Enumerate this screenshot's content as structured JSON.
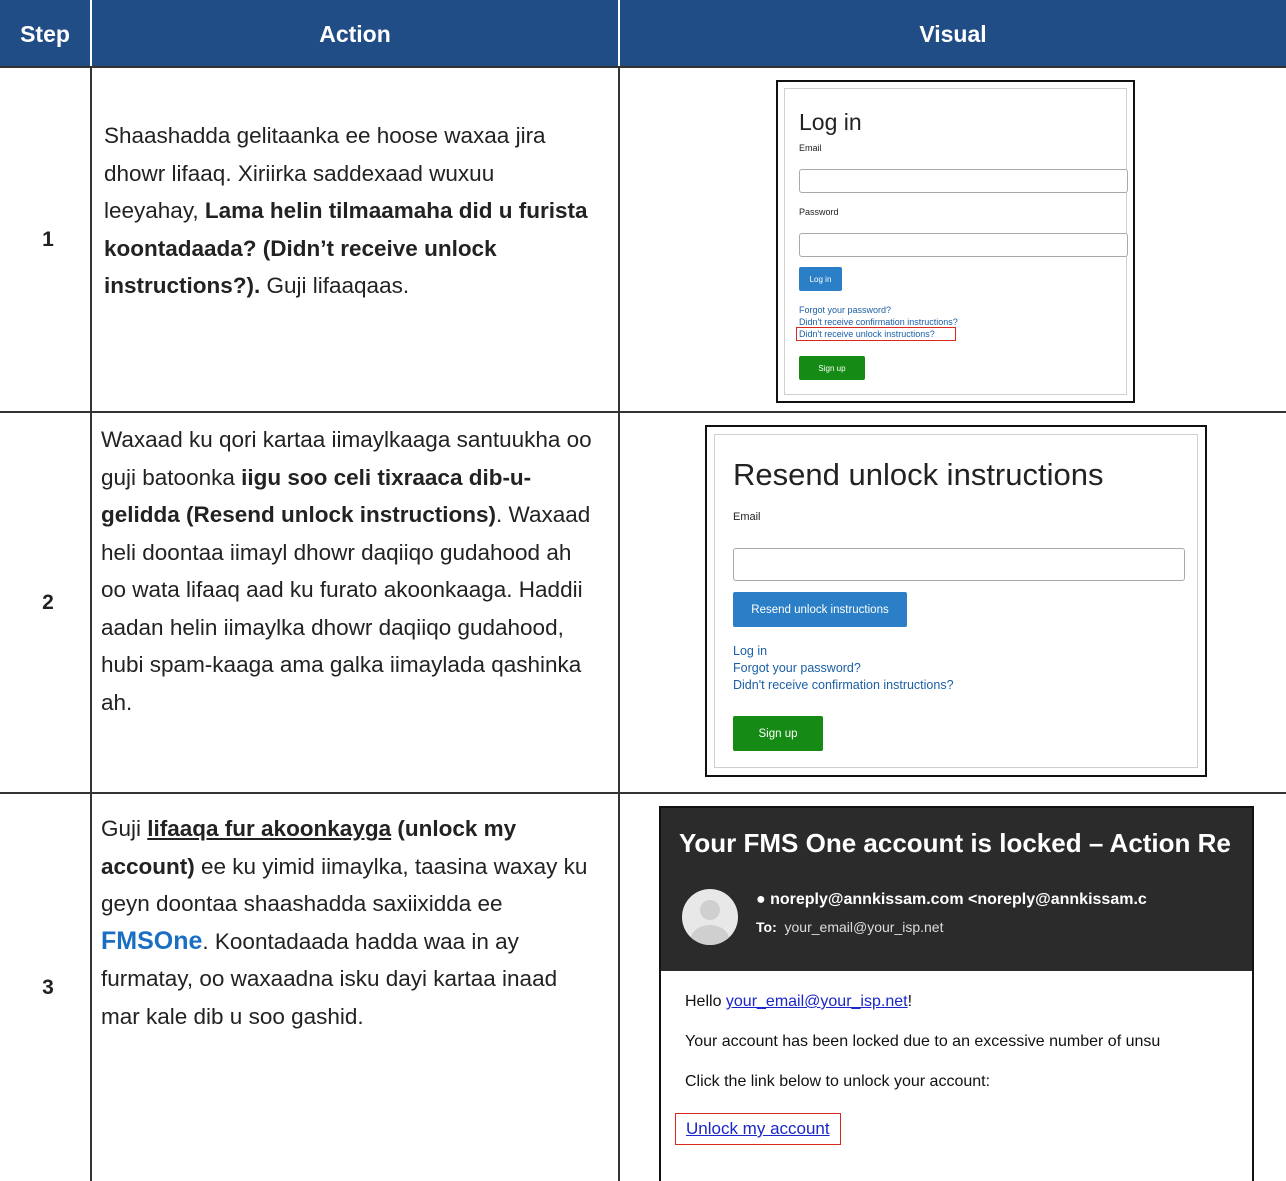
{
  "header": {
    "step": "Step",
    "action": "Action",
    "visual": "Visual"
  },
  "rows": [
    {
      "step": "1",
      "action": {
        "pre": "Shaashadda gelitaanka ee hoose waxaa jira dhowr lifaaq. Xiriirka saddexaad wuxuu leeyahay, ",
        "bold": "Lama helin tilmaamaha did u furista koontadaada? (Didn’t receive unlock instructions?).",
        "post": " Guji lifaaqaas."
      },
      "visual": {
        "title": "Log in",
        "email_label": "Email",
        "password_label": "Password",
        "login_button": "Log in",
        "links": [
          "Forgot your password?",
          "Didn't receive confirmation instructions?",
          "Didn't receive unlock instructions?"
        ],
        "signup_button": "Sign up"
      }
    },
    {
      "step": "2",
      "action": {
        "pre": "Waxaad ku qori kartaa iimaylkaaga santuukha oo guji batoonka ",
        "bold": "iigu soo celi tixraaca dib-u-gelidda (Resend unlock instructions)",
        "post": ". Waxaad heli doontaa iimayl dhowr daqiiqo gudahood ah oo wata lifaaq aad ku furato akoonkaaga. Haddii aadan helin iimaylka dhowr daqiiqo gudahood, hubi spam-kaaga ama galka iimaylada qashinka ah."
      },
      "visual": {
        "title": "Resend unlock instructions",
        "email_label": "Email",
        "resend_button": "Resend unlock instructions",
        "links": [
          "Log in",
          "Forgot your password?",
          "Didn't receive confirmation instructions?"
        ],
        "signup_button": "Sign up"
      }
    },
    {
      "step": "3",
      "action": {
        "pre": "Guji ",
        "underlined": "lifaaqa fur akoonkayga",
        "bold_after": " (unlock my account)",
        "mid": " ee ku yimid iimaylka, taasina waxay ku geyn doontaa shaashadda saxiixidda ee ",
        "brand": "FMSOne",
        "post": ". Koontadaada hadda waa in ay furmatay, oo waxaadna isku dayi kartaa inaad mar kale dib u soo gashid."
      },
      "visual": {
        "subject": "Your FMS One account is locked – Action Re",
        "from": "● noreply@annkissam.com <noreply@annkissam.c",
        "to_label": "To:",
        "to_value": "your_email@your_isp.net",
        "hello_prefix": "Hello ",
        "hello_link": "your_email@your_isp.net",
        "hello_suffix": "!",
        "body1": "Your account has been locked due to an excessive number of unsu",
        "body2": "Click the link below to unlock your account:",
        "unlock_link": "Unlock my account"
      }
    }
  ],
  "colors": {
    "header_bg": "#214d86",
    "login_button": "#2a7fc6",
    "signup_button": "#158a14",
    "highlight": "#d9291f",
    "link": "#1b5fa6",
    "brand": "#1a6fc2"
  }
}
